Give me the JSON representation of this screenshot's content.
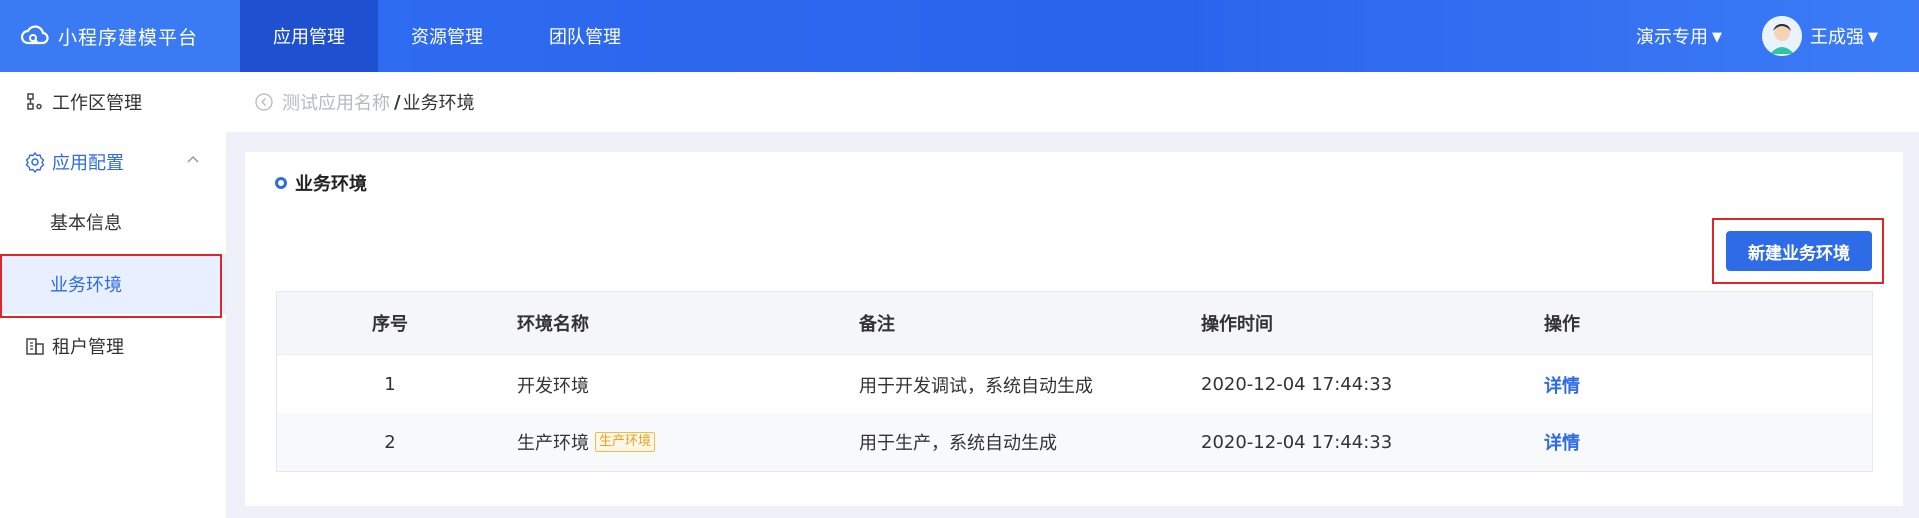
{
  "header": {
    "brand_name": "小程序建模平台",
    "nav": [
      "应用管理",
      "资源管理",
      "团队管理"
    ],
    "active_nav": "应用管理",
    "tenant_label": "演示专用",
    "user_name": "王成强"
  },
  "sidebar": {
    "items": [
      {
        "label": "工作区管理",
        "icon": "workspace-icon"
      },
      {
        "label": "应用配置",
        "icon": "gear-icon",
        "expanded": true
      },
      {
        "label": "基本信息"
      },
      {
        "label": "业务环境",
        "selected": true
      },
      {
        "label": "租户管理",
        "icon": "building-icon"
      }
    ]
  },
  "breadcrumb": {
    "parent": "测试应用名称",
    "separator": "/",
    "current": "业务环境"
  },
  "main": {
    "section_title": "业务环境",
    "new_button_label": "新建业务环境",
    "table": {
      "columns": [
        "序号",
        "环境名称",
        "备注",
        "操作时间",
        "操作"
      ],
      "rows": [
        {
          "index": "1",
          "name": "开发环境",
          "tag": "",
          "note": "用于开发调试，系统自动生成",
          "time": "2020-12-04 17:44:33",
          "action": "详情"
        },
        {
          "index": "2",
          "name": "生产环境",
          "tag": "生产环境",
          "note": "用于生产，系统自动生成",
          "time": "2020-12-04 17:44:33",
          "action": "详情"
        }
      ]
    }
  },
  "colors": {
    "primary": "#2e6be6",
    "header_bg": "#2f6ff2",
    "highlight": "#e0242b",
    "tag": "#f0a020"
  }
}
